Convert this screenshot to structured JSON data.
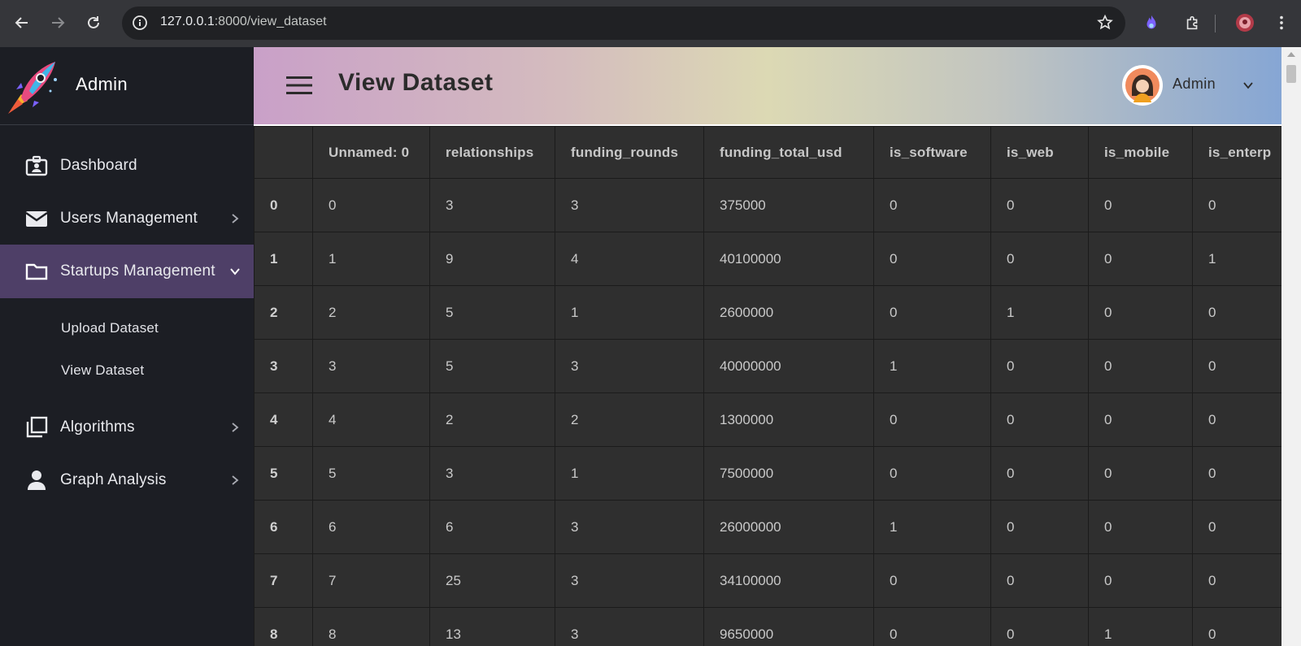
{
  "browser": {
    "url_host": "127.0.0.1",
    "url_rest": ":8000/view_dataset",
    "icons": [
      "back-arrow-icon",
      "forward-arrow-icon",
      "reload-icon",
      "site-info-icon",
      "bookmark-star-icon",
      "extension-flame-icon",
      "extensions-puzzle-icon",
      "profile-avatar-icon",
      "more-menu-icon"
    ]
  },
  "sidebar": {
    "brand": "Admin",
    "items": [
      {
        "label": "Dashboard",
        "icon": "id-badge-icon"
      },
      {
        "label": "Users Management",
        "icon": "envelope-icon"
      },
      {
        "label": "Startups Management",
        "icon": "folder-icon"
      },
      {
        "label": "Algorithms",
        "icon": "copy-stack-icon"
      },
      {
        "label": "Graph Analysis",
        "icon": "user-icon"
      }
    ],
    "sub_items": [
      {
        "label": "Upload Dataset"
      },
      {
        "label": "View Dataset"
      }
    ],
    "active_color": "#4e3f67"
  },
  "header": {
    "title": "View Dataset",
    "user_name": "Admin"
  },
  "table": {
    "columns": [
      "",
      "Unnamed: 0",
      "relationships",
      "funding_rounds",
      "funding_total_usd",
      "is_software",
      "is_web",
      "is_mobile",
      "is_enterp"
    ],
    "rows": [
      [
        "0",
        "0",
        "3",
        "3",
        "375000",
        "0",
        "0",
        "0",
        "0"
      ],
      [
        "1",
        "1",
        "9",
        "4",
        "40100000",
        "0",
        "0",
        "0",
        "1"
      ],
      [
        "2",
        "2",
        "5",
        "1",
        "2600000",
        "0",
        "1",
        "0",
        "0"
      ],
      [
        "3",
        "3",
        "5",
        "3",
        "40000000",
        "1",
        "0",
        "0",
        "0"
      ],
      [
        "4",
        "4",
        "2",
        "2",
        "1300000",
        "0",
        "0",
        "0",
        "0"
      ],
      [
        "5",
        "5",
        "3",
        "1",
        "7500000",
        "0",
        "0",
        "0",
        "0"
      ],
      [
        "6",
        "6",
        "6",
        "3",
        "26000000",
        "1",
        "0",
        "0",
        "0"
      ],
      [
        "7",
        "7",
        "25",
        "3",
        "34100000",
        "0",
        "0",
        "0",
        "0"
      ],
      [
        "8",
        "8",
        "13",
        "3",
        "9650000",
        "0",
        "0",
        "1",
        "0"
      ]
    ]
  }
}
